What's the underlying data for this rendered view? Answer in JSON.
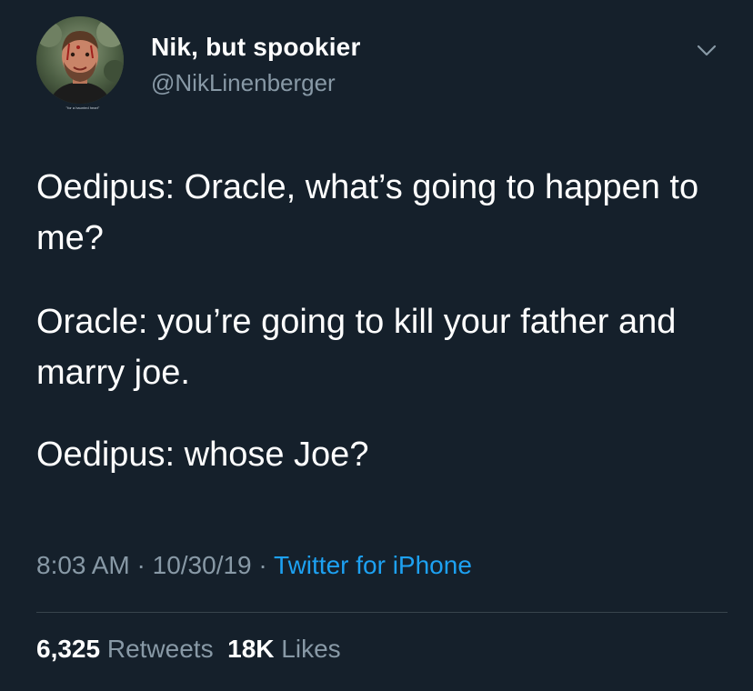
{
  "author": {
    "display_name": "Nik, but spookier",
    "handle": "@NikLinenberger",
    "avatar_caption": "\"for a haunted heart\""
  },
  "tweet": {
    "paragraphs": [
      "Oedipus: Oracle, what’s going to happen to me?",
      "Oracle: you’re going to kill your father and marry joe.",
      "Oedipus: whose Joe?"
    ],
    "time": "8:03 AM",
    "separator": " · ",
    "date": "10/30/19",
    "source": "Twitter for iPhone"
  },
  "stats": {
    "retweets_count": "6,325",
    "retweets_label": "Retweets",
    "likes_count": "18K",
    "likes_label": "Likes"
  },
  "colors": {
    "background": "#15202b",
    "text_primary": "#ffffff",
    "text_secondary": "#8899a6",
    "link": "#1da1f2",
    "divider": "#38444d"
  },
  "icons": {
    "avatar": "avatar-image",
    "caret": "chevron-down-icon"
  }
}
